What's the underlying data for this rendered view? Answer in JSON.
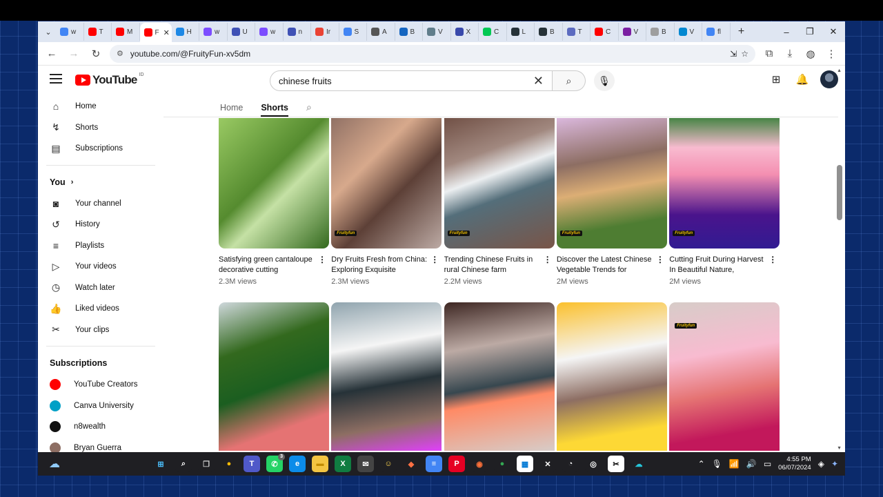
{
  "browser": {
    "tabs": [
      {
        "letter": "w",
        "color": "#4285f4"
      },
      {
        "letter": "T",
        "color": "#ff0000"
      },
      {
        "letter": "M",
        "color": "#ff0000"
      },
      {
        "letter": "F",
        "color": "#ff0000",
        "active": true
      },
      {
        "letter": "H",
        "color": "#1e88e5"
      },
      {
        "letter": "w",
        "color": "#7c4dff"
      },
      {
        "letter": "U",
        "color": "#3f51b5"
      },
      {
        "letter": "w",
        "color": "#7c4dff"
      },
      {
        "letter": "n",
        "color": "#3f51b5"
      },
      {
        "letter": "Ir",
        "color": "#ea4335"
      },
      {
        "letter": "S",
        "color": "#4285f4"
      },
      {
        "letter": "A",
        "color": "#555555"
      },
      {
        "letter": "B",
        "color": "#1565c0"
      },
      {
        "letter": "V",
        "color": "#607d8b"
      },
      {
        "letter": "X",
        "color": "#3949ab"
      },
      {
        "letter": "C",
        "color": "#00c853"
      },
      {
        "letter": "L",
        "color": "#263238"
      },
      {
        "letter": "B",
        "color": "#263238"
      },
      {
        "letter": "T",
        "color": "#5c6bc0"
      },
      {
        "letter": "C",
        "color": "#ff0000"
      },
      {
        "letter": "V",
        "color": "#7b1fa2"
      },
      {
        "letter": "B",
        "color": "#9e9e9e"
      },
      {
        "letter": "V",
        "color": "#0288d1"
      },
      {
        "letter": "fl",
        "color": "#4285f4"
      }
    ],
    "url": "youtube.com/@FruityFun-xv5dm"
  },
  "header": {
    "logo_text": "YouTube",
    "country_code": "ID",
    "search_value": "chinese fruits"
  },
  "sidebar": {
    "main": [
      {
        "label": "Home",
        "icon": "⌂"
      },
      {
        "label": "Shorts",
        "icon": "↯"
      },
      {
        "label": "Subscriptions",
        "icon": "▤"
      }
    ],
    "you_heading": "You",
    "you": [
      {
        "label": "Your channel",
        "icon": "◙"
      },
      {
        "label": "History",
        "icon": "↺"
      },
      {
        "label": "Playlists",
        "icon": "≡"
      },
      {
        "label": "Your videos",
        "icon": "▷"
      },
      {
        "label": "Watch later",
        "icon": "◷"
      },
      {
        "label": "Liked videos",
        "icon": "👍"
      },
      {
        "label": "Your clips",
        "icon": "✂"
      }
    ],
    "subscriptions_heading": "Subscriptions",
    "subscriptions": [
      {
        "label": "YouTube Creators",
        "color": "#ff0000"
      },
      {
        "label": "Canva University",
        "color": "#00a0c6"
      },
      {
        "label": "n8wealth",
        "color": "#111111"
      },
      {
        "label": "Bryan Guerra",
        "color": "#8d6e63"
      }
    ]
  },
  "channel_tabs": [
    "Home",
    "Shorts"
  ],
  "shorts": [
    {
      "title": "Satisfying green cantaloupe decorative cutting",
      "views": "2.3M views",
      "bg": "linear-gradient(135deg,#9ccc65,#558b2f 45%,#c5e1a5 60%,#33691e)"
    },
    {
      "title": "Dry Fruits Fresh from China: Exploring Exquisite Flavors...",
      "views": "2.3M views",
      "bg": "linear-gradient(135deg,#8d6e63,#d7a98c 35%,#5d4037 60%,#bcaaa4)"
    },
    {
      "title": "Trending Chinese Fruits in rural Chinese farm",
      "views": "2.2M views",
      "bg": "linear-gradient(160deg,#6d4c41,#a1887f 30%,#eceff1 45%,#546e7a 60%,#795548)"
    },
    {
      "title": "Discover the Latest Chinese Vegetable Trends for High-...",
      "views": "2M views",
      "bg": "linear-gradient(170deg,#e1bee7,#8d6e63 35%,#dcae75 55%,#4e7d32 80%)"
    },
    {
      "title": "Cutting Fruit During Harvest In Beautiful Nature,",
      "views": "2M views",
      "bg": "linear-gradient(180deg,#2e7d32,#f8bbd0 25%,#f48fb1 45%,#4a148c 75%,#311b92)"
    },
    {
      "title": "",
      "views": "",
      "bg": "linear-gradient(160deg,#cfd8dc,#33691e 30%,#1b5e20 55%,#e57373 80%)"
    },
    {
      "title": "",
      "views": "",
      "bg": "linear-gradient(170deg,#90a4ae,#f5f5f5 30%,#263238 55%,#8d6e63 80%,#e040fb)"
    },
    {
      "title": "",
      "views": "",
      "bg": "linear-gradient(170deg,#3e2723,#bcaaa4 30%,#37474f 55%,#ff8a65 65%,#d7ccc8)"
    },
    {
      "title": "",
      "views": "",
      "bg": "linear-gradient(170deg,#fbc02d,#f5f5f5 35%,#8d6e63 60%,#fdd835 85%)"
    },
    {
      "title": "",
      "views": "",
      "bg": "linear-gradient(170deg,#d7ccc8,#f8bbd0 35%,#e57373 60%,#c2185b 85%)"
    }
  ],
  "shorts_brand": "Fruityfun",
  "taskbar": {
    "time": "4:55 PM",
    "date": "06/07/2024",
    "badge_whatsapp": "3",
    "apps": [
      {
        "name": "windows-start",
        "label": "⊞",
        "bg": "#1f1f23",
        "fg": "#4cc2ff"
      },
      {
        "name": "search",
        "label": "⌕",
        "bg": "#1f1f23",
        "fg": "#ffffff"
      },
      {
        "name": "task-view",
        "label": "❐",
        "bg": "#1f1f23",
        "fg": "#cccccc"
      },
      {
        "name": "chrome",
        "label": "●",
        "bg": "#1f1f23",
        "fg": "#fbbc05"
      },
      {
        "name": "teams",
        "label": "T",
        "bg": "#5059c9",
        "fg": "#ffffff"
      },
      {
        "name": "whatsapp",
        "label": "✆",
        "bg": "#25d366",
        "fg": "#ffffff"
      },
      {
        "name": "edge",
        "label": "e",
        "bg": "#0c8ce9",
        "fg": "#ffffff"
      },
      {
        "name": "file-explorer",
        "label": "▬",
        "bg": "#f4c542",
        "fg": "#c28b00"
      },
      {
        "name": "excel",
        "label": "X",
        "bg": "#107c41",
        "fg": "#ffffff"
      },
      {
        "name": "mail",
        "label": "✉",
        "bg": "#444444",
        "fg": "#ffffff"
      },
      {
        "name": "character",
        "label": "☺",
        "bg": "#1f1f23",
        "fg": "#ffd54f"
      },
      {
        "name": "app-store",
        "label": "◆",
        "bg": "#1f1f23",
        "fg": "#ff7043"
      },
      {
        "name": "docs",
        "label": "≡",
        "bg": "#4285f4",
        "fg": "#ffffff"
      },
      {
        "name": "pinterest",
        "label": "P",
        "bg": "#e60023",
        "fg": "#ffffff"
      },
      {
        "name": "firefox",
        "label": "◉",
        "bg": "#1f1f23",
        "fg": "#ff7139"
      },
      {
        "name": "chrome-2",
        "label": "●",
        "bg": "#1f1f23",
        "fg": "#34a853"
      },
      {
        "name": "store",
        "label": "▦",
        "bg": "#ffffff",
        "fg": "#0078d4"
      },
      {
        "name": "capcut",
        "label": "✕",
        "bg": "#1f1f23",
        "fg": "#ffffff"
      },
      {
        "name": "clock",
        "label": "◔",
        "bg": "#1f1f23",
        "fg": "#ffffff"
      },
      {
        "name": "obs",
        "label": "◎",
        "bg": "#1f1f23",
        "fg": "#ffffff"
      },
      {
        "name": "capcut-2",
        "label": "✂",
        "bg": "#ffffff",
        "fg": "#000000"
      },
      {
        "name": "cloud-upload",
        "label": "☁",
        "bg": "#1f1f23",
        "fg": "#26c6da"
      }
    ]
  }
}
